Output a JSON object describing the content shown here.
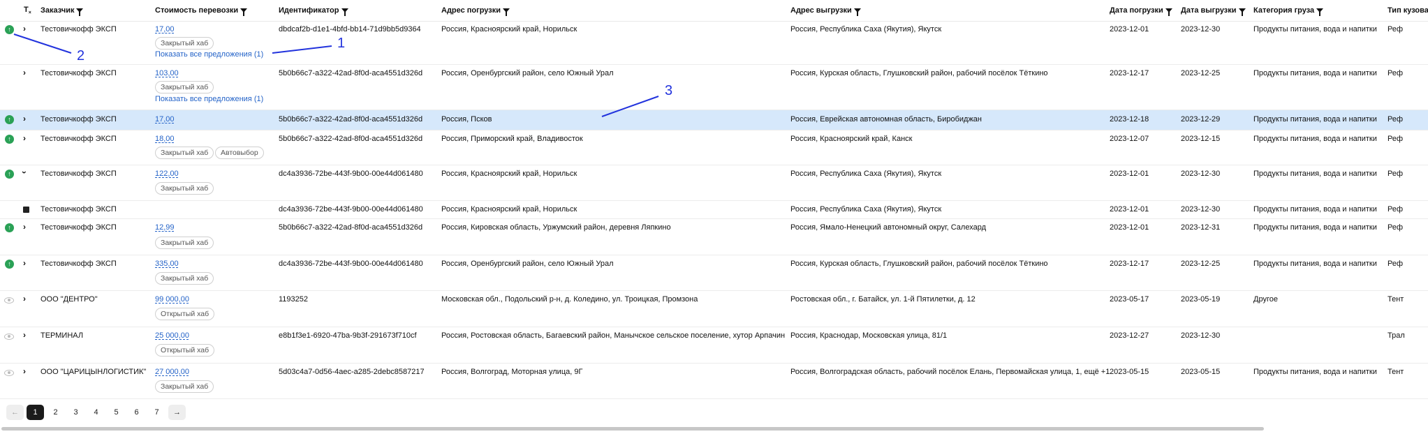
{
  "header": {
    "customer": "Заказчик",
    "cost": "Стоимость перевозки",
    "id": "Идентификатор",
    "load_addr": "Адрес погрузки",
    "unload_addr": "Адрес выгрузки",
    "load_date": "Дата погрузки",
    "unload_date": "Дата выгрузки",
    "cargo": "Категория груза",
    "body": "Тип кузова"
  },
  "chips": {
    "closed_hub": "Закрытый хаб",
    "open_hub": "Открытый хаб",
    "auto": "Автовыбор"
  },
  "rows": [
    {
      "customer": "Тестовичкофф ЭКСП",
      "cost": "17,00",
      "id": "dbdcaf2b-d1e1-4bfd-bb14-71d9bb5d9364",
      "load": "Россия, Красноярский край, Норильск",
      "unload": "Россия, Республика Саха (Якутия), Якутск",
      "d1": "2023-12-01",
      "d2": "2023-12-30",
      "cargo": "Продукты питания, вода и напитки",
      "body": "Реф",
      "offers": "Показать все предложения (1)"
    },
    {
      "customer": "Тестовичкофф ЭКСП",
      "cost": "103,00",
      "id": "5b0b66c7-a322-42ad-8f0d-aca4551d326d",
      "load": "Россия, Оренбургский район, село Южный Урал",
      "unload": "Россия, Курская область, Глушковский район, рабочий посёлок Тёткино",
      "d1": "2023-12-17",
      "d2": "2023-12-25",
      "cargo": "Продукты питания, вода и напитки",
      "body": "Реф",
      "offers": "Показать все предложения (1)"
    },
    {
      "customer": "Тестовичкофф ЭКСП",
      "cost": "17,00",
      "id": "5b0b66c7-a322-42ad-8f0d-aca4551d326d",
      "load": "Россия, Псков",
      "unload": "Россия, Еврейская автономная область, Биробиджан",
      "d1": "2023-12-18",
      "d2": "2023-12-29",
      "cargo": "Продукты питания, вода и напитки",
      "body": "Реф"
    },
    {
      "customer": "Тестовичкофф ЭКСП",
      "cost": "18,00",
      "id": "5b0b66c7-a322-42ad-8f0d-aca4551d326d",
      "load": "Россия, Приморский край, Владивосток",
      "unload": "Россия, Красноярский край, Канск",
      "d1": "2023-12-07",
      "d2": "2023-12-15",
      "cargo": "Продукты питания, вода и напитки",
      "body": "Реф"
    },
    {
      "customer": "Тестовичкофф ЭКСП",
      "cost": "122,00",
      "id": "dc4a3936-72be-443f-9b00-00e44d061480",
      "load": "Россия, Красноярский край, Норильск",
      "unload": "Россия, Республика Саха (Якутия), Якутск",
      "d1": "2023-12-01",
      "d2": "2023-12-30",
      "cargo": "Продукты питания, вода и напитки",
      "body": "Реф"
    },
    {
      "customer": "Тестовичкофф ЭКСП",
      "id": "dc4a3936-72be-443f-9b00-00e44d061480",
      "load": "Россия, Красноярский край, Норильск",
      "unload": "Россия, Республика Саха (Якутия), Якутск",
      "d1": "2023-12-01",
      "d2": "2023-12-30",
      "cargo": "Продукты питания, вода и напитки",
      "body": "Реф"
    },
    {
      "customer": "Тестовичкофф ЭКСП",
      "cost": "12,99",
      "id": "5b0b66c7-a322-42ad-8f0d-aca4551d326d",
      "load": "Россия, Кировская область, Уржумский район, деревня Ляпкино",
      "unload": "Россия, Ямало-Ненецкий автономный округ, Салехард",
      "d1": "2023-12-01",
      "d2": "2023-12-31",
      "cargo": "Продукты питания, вода и напитки",
      "body": "Реф"
    },
    {
      "customer": "Тестовичкофф ЭКСП",
      "cost": "335,00",
      "id": "dc4a3936-72be-443f-9b00-00e44d061480",
      "load": "Россия, Оренбургский район, село Южный Урал",
      "unload": "Россия, Курская область, Глушковский район, рабочий посёлок Тёткино",
      "d1": "2023-12-17",
      "d2": "2023-12-25",
      "cargo": "Продукты питания, вода и напитки",
      "body": "Реф"
    },
    {
      "customer": "ООО \"ДЕНТРО\"",
      "cost": "99 000,00",
      "id": "1193252",
      "load": "Московская обл., Подольский р-н, д. Коледино, ул. Троицкая, Промзона",
      "unload": "Ростовская обл., г. Батайск, ул. 1-й Пятилетки, д. 12",
      "d1": "2023-05-17",
      "d2": "2023-05-19",
      "cargo": "Другое",
      "body": "Тент"
    },
    {
      "customer": "ТЕРМИНАЛ",
      "cost": "25 000,00",
      "id": "e8b1f3e1-6920-47ba-9b3f-291673f710cf",
      "load": "Россия, Ростовская область, Багаевский район, Манычское сельское поселение, хутор Арпачин",
      "unload": "Россия, Краснодар, Московская улица, 81/1",
      "d1": "2023-12-27",
      "d2": "2023-12-30",
      "cargo": "",
      "body": "Трал"
    },
    {
      "customer": "ООО \"ЦАРИЦЫНЛОГИСТИК\"",
      "cost": "27 000,00",
      "id": "5d03c4a7-0d56-4aec-a285-2debc8587217",
      "load": "Россия, Волгоград, Моторная улица, 9Г",
      "unload": "Россия, Волгоградская область, рабочий посёлок Елань, Первомайская улица, 1, ещё +1",
      "d1": "2023-05-15",
      "d2": "2023-05-15",
      "cargo": "Продукты питания, вода и напитки",
      "body": "Тент"
    }
  ],
  "pagination": {
    "pages": [
      "1",
      "2",
      "3",
      "4",
      "5",
      "6",
      "7"
    ],
    "current": "1",
    "prev": "←",
    "next": "→"
  },
  "annotations": {
    "a1": "1",
    "a2": "2",
    "a3": "3"
  }
}
